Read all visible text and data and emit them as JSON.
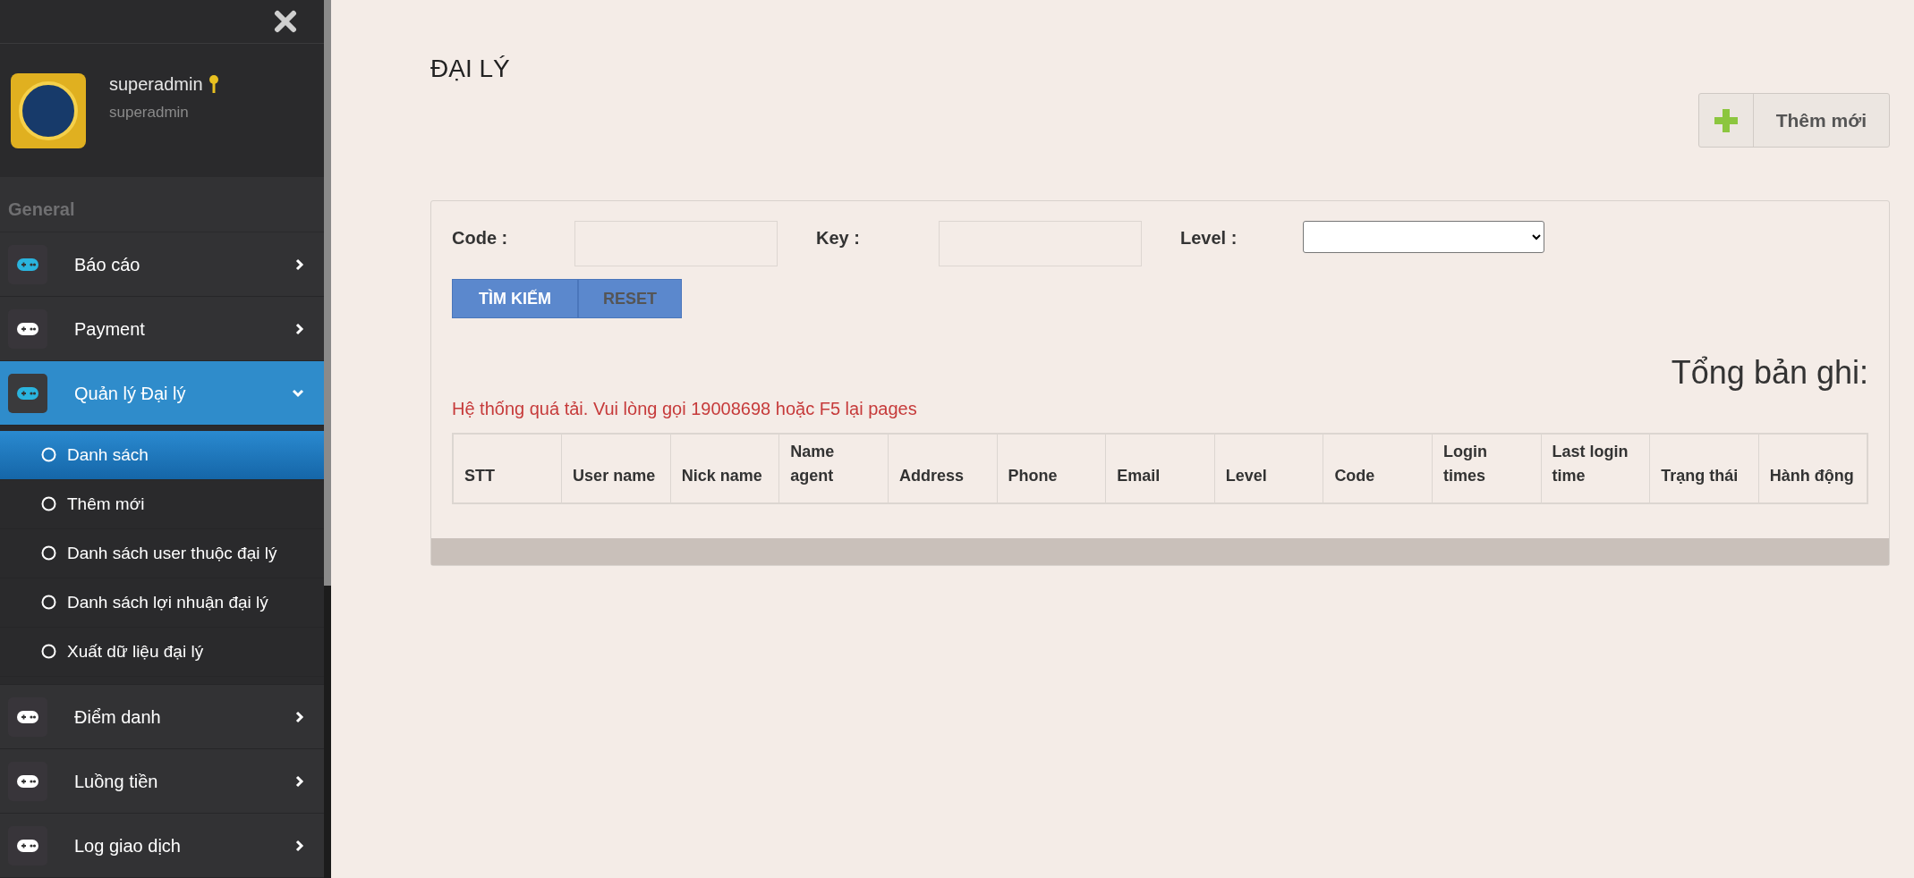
{
  "sidebar": {
    "profile": {
      "name": "superadmin",
      "role": "superadmin"
    },
    "section": "General",
    "items": [
      {
        "label": "Báo cáo",
        "color": "#2ab4de",
        "expanded": false,
        "selected": false
      },
      {
        "label": "Payment",
        "color": "#ffffff",
        "expanded": false,
        "selected": false
      },
      {
        "label": "Quản lý Đại lý",
        "color": "#2ab4de",
        "expanded": true,
        "selected": true,
        "children": [
          {
            "label": "Danh sách",
            "selected": true
          },
          {
            "label": "Thêm mới",
            "selected": false
          },
          {
            "label": "Danh sách user thuộc đại lý",
            "selected": false
          },
          {
            "label": "Danh sách lợi nhuận đại lý",
            "selected": false
          },
          {
            "label": "Xuất dữ liệu đại lý",
            "selected": false
          }
        ]
      },
      {
        "label": "Điểm danh",
        "color": "#ffffff",
        "expanded": false,
        "selected": false
      },
      {
        "label": "Luồng tiền",
        "color": "#ffffff",
        "expanded": false,
        "selected": false
      },
      {
        "label": "Log giao dịch",
        "color": "#ffffff",
        "expanded": false,
        "selected": false
      }
    ]
  },
  "page": {
    "title": "ĐẠI LÝ",
    "add_button": "Thêm mới"
  },
  "search": {
    "fields": [
      {
        "label": "Code :",
        "kind": "input"
      },
      {
        "label": "Key :",
        "kind": "input"
      },
      {
        "label": "Level :",
        "kind": "select"
      }
    ],
    "buttons": [
      {
        "label": "TÌM KIẾM",
        "kind": "primary"
      },
      {
        "label": "RESET",
        "kind": "secondary"
      }
    ]
  },
  "total_label": "Tổng bản ghi:",
  "error": "Hệ thống quá tải. Vui lòng gọi 19008698 hoặc F5 lại pages",
  "table": {
    "columns": [
      "STT",
      "User name",
      "Nick name",
      "Name agent",
      "Address",
      "Phone",
      "Email",
      "Level",
      "Code",
      "Login times",
      "Last login time",
      "Trạng thái",
      "Hành động"
    ]
  }
}
